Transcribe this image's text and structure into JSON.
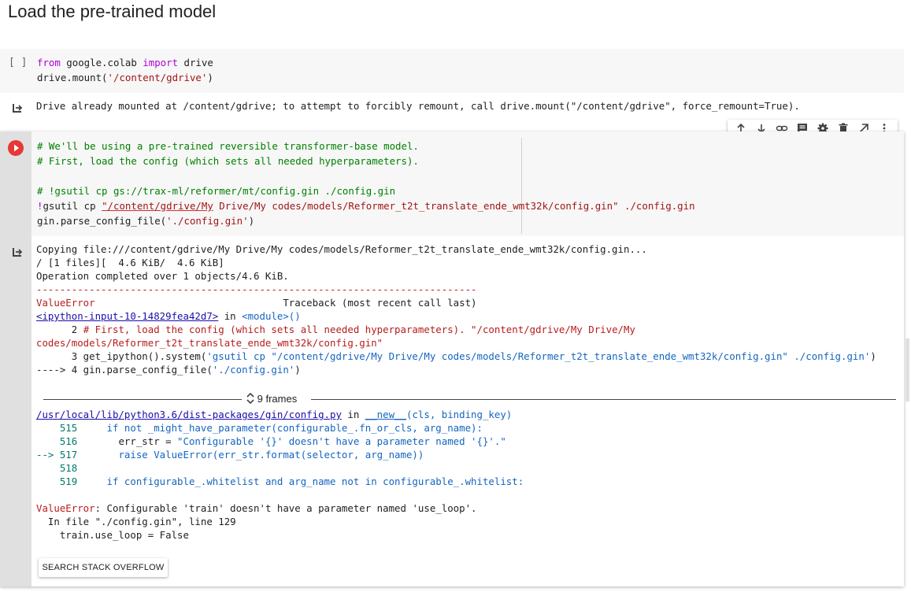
{
  "heading": "Load the pre-trained model",
  "cell1": {
    "run_label": "[ ]",
    "code": {
      "l1_kw1": "from",
      "l1_mid": " google.colab ",
      "l1_kw2": "import",
      "l1_end": " drive",
      "l2_pre": "drive.mount(",
      "l2_str": "'/content/gdrive'",
      "l2_end": ")"
    },
    "output": "Drive already mounted at /content/gdrive; to attempt to forcibly remount, call drive.mount(\"/content/gdrive\", force_remount=True)."
  },
  "toolbar": {
    "icons": [
      "arrow-up-icon",
      "arrow-down-icon",
      "link-icon",
      "comment-icon",
      "gear-icon",
      "trash-icon",
      "open-in-icon",
      "more-icon"
    ]
  },
  "cell2": {
    "code": {
      "c1": "# We'll be using a pre-trained reversible transformer-base model.",
      "c2": "# First, load the config (which sets all needed hyperparameters).",
      "c3": "# !gsutil cp gs://trax-ml/reformer/mt/config.gin ./config.gin",
      "l4_bang": "!",
      "l4_cmd": "gsutil cp ",
      "l4_str": "\"/content/gdrive/My",
      "l4_rest": " Drive/My codes/models/Reformer_t2t_translate_ende_wmt32k/config.gin\" ./config.gin",
      "l5_pre": "gin.parse_config_file(",
      "l5_str": "'./config.gin'",
      "l5_end": ")"
    },
    "output": {
      "o1": "Copying file:///content/gdrive/My Drive/My codes/models/Reformer_t2t_translate_ende_wmt32k/config.gin...",
      "o2": "/ [1 files][  4.6 KiB/  4.6 KiB]",
      "o3": "Operation completed over 1 objects/4.6 KiB.",
      "o4": "---------------------------------------------------------------------------",
      "err_name": "ValueError",
      "tb_label": "                                Traceback (most recent call last)",
      "ipy_link": "<ipython-input-10-14829fea42d7>",
      "in_word": " in ",
      "module": "<module>()",
      "t2a": "      2 ",
      "t2b": "# First, load the config (which sets all needed hyperparameters). \"/content/gdrive/My Drive/My",
      "t2c": "codes/models/Reformer_t2t_translate_ende_wmt32k/config.gin\"",
      "t3a": "      3 get_ipython().system(",
      "t3b": "'gsutil cp \"/content/gdrive/My Drive/My codes/models/Reformer_t2t_translate_ende_wmt32k/config.gin\" ./config.gin'",
      "t3c": ")",
      "t4a": "----> 4",
      "t4b": " gin.parse_config_file(",
      "t4c": "'./config.gin'",
      "t4d": ")",
      "frames": "9 frames",
      "file_link": "/usr/local/lib/python3.6/dist-packages/gin/config.py",
      "file_in": " in ",
      "func": "__new__",
      "func_args": "(cls, binding_key)",
      "l515n": "    515 ",
      "l515": "    if not _might_have_parameter(configurable_.fn_or_cls, arg_name):",
      "l516n": "    516 ",
      "l516a": "      err_str = ",
      "l516b": "\"Configurable '{}' doesn't have a parameter named '{}'.\"",
      "l517n": "--> 517 ",
      "l517": "      raise ValueError(err_str.format(selector, arg_name))",
      "l518n": "    518 ",
      "l519n": "    519 ",
      "l519": "    if configurable_.whitelist and arg_name not in configurable_.whitelist:",
      "final_err": "ValueError",
      "final_msg": ": Configurable 'train' doesn't have a parameter named 'use_loop'.",
      "f2": "  In file \"./config.gin\", line 129",
      "f3": "    train.use_loop = False"
    },
    "so_button": "SEARCH STACK OVERFLOW"
  }
}
